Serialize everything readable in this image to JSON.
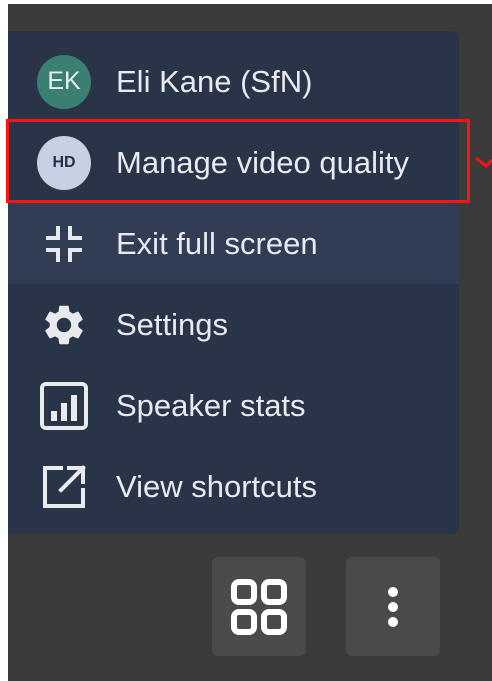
{
  "menu": {
    "items": [
      {
        "label": "Eli Kane (SfN)",
        "avatar_initials": "EK",
        "icon": "avatar",
        "avatar_color": "#3a7f71"
      },
      {
        "label": "Manage video quality",
        "badge_text": "HD",
        "icon": "hd-badge",
        "highlighted": true
      },
      {
        "label": "Exit full screen",
        "icon": "exit-fullscreen-icon",
        "hovered": true
      },
      {
        "label": "Settings",
        "icon": "gear-icon"
      },
      {
        "label": "Speaker stats",
        "icon": "bar-chart-icon"
      },
      {
        "label": "View shortcuts",
        "icon": "external-link-icon"
      }
    ]
  },
  "toolbar": {
    "buttons": [
      {
        "icon": "tile-view-icon"
      },
      {
        "icon": "more-vertical-icon"
      }
    ]
  },
  "colors": {
    "menu_background": "#2a3448",
    "hover_background": "#313d55",
    "highlight_border": "#ff1212",
    "text": "#e8eaee"
  }
}
